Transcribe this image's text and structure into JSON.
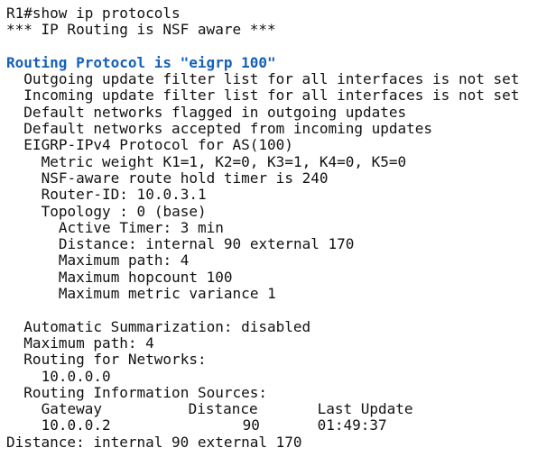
{
  "terminal": {
    "prompt": "R1#show ip protocols",
    "nsf_banner": "*** IP Routing is NSF aware ***",
    "protocol_header": "Routing Protocol is \"eigrp 100\"",
    "accent_color": "#1560b8",
    "lines": {
      "outgoing_filter": "Outgoing update filter list for all interfaces is not set",
      "incoming_filter": "Incoming update filter list for all interfaces is not set",
      "default_flagged": "Default networks flagged in outgoing updates",
      "default_accepted": "Default networks accepted from incoming updates",
      "eigrp_as": "EIGRP-IPv4 Protocol for AS(100)",
      "metric_weight": "Metric weight K1=1, K2=0, K3=1, K4=0, K5=0",
      "nsf_timer": "NSF-aware route hold timer is 240",
      "router_id": "Router-ID: 10.0.3.1",
      "topology": "Topology : 0 (base)",
      "active_timer": "Active Timer: 3 min",
      "distance_topo": "Distance: internal 90 external 170",
      "max_path_topo": "Maximum path: 4",
      "max_hopcount": "Maximum hopcount 100",
      "max_variance": "Maximum metric variance 1",
      "auto_summary": "Automatic Summarization: disabled",
      "max_path": "Maximum path: 4",
      "routing_networks": "Routing for Networks:",
      "network_1": "10.0.0.0",
      "info_sources": "Routing Information Sources:",
      "distance_final": "Distance: internal 90 external 170"
    },
    "sources_table": {
      "headers": [
        "Gateway",
        "Distance",
        "Last Update"
      ],
      "rows": [
        [
          "10.0.0.2",
          "90",
          "01:49:37"
        ]
      ]
    }
  }
}
